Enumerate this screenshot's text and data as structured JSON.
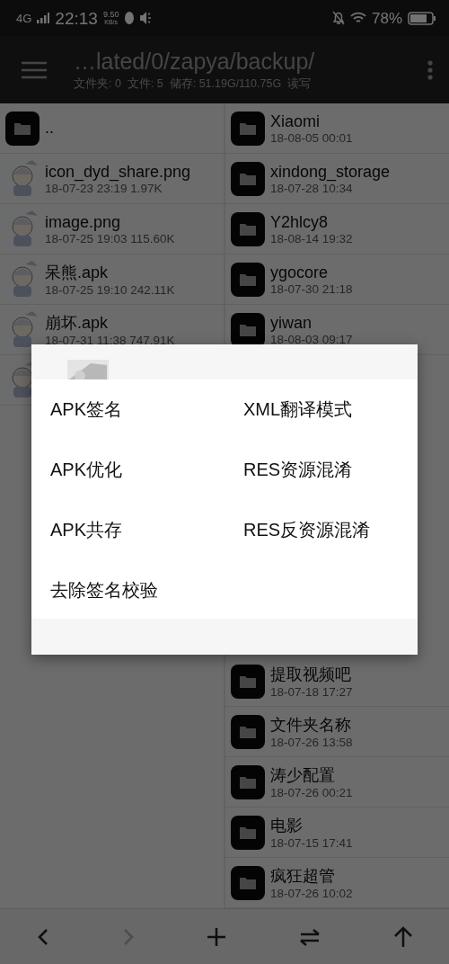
{
  "status_bar": {
    "network": "4G",
    "time": "22:13",
    "speed": "9.50",
    "speed_unit": "KB/s",
    "battery": "78%"
  },
  "app_bar": {
    "path": "…lated/0/zapya/backup/",
    "summary": "文件夹: 0  文件: 5  储存: 51.19G/110.75G  读写"
  },
  "left_pane": [
    {
      "kind": "folder",
      "name": ".."
    },
    {
      "kind": "picture",
      "name": "icon_dyd_share.png",
      "meta": "18-07-23 23:19  1.97K"
    },
    {
      "kind": "picture",
      "name": "image.png",
      "meta": "18-07-25 19:03  115.60K"
    },
    {
      "kind": "picture",
      "name": "呆熊.apk",
      "meta": "18-07-25 19:10  242.11K"
    },
    {
      "kind": "picture",
      "name": "崩坏.apk",
      "meta": "18-07-31 11:38  747.91K"
    },
    {
      "kind": "picture"
    }
  ],
  "right_pane_top": [
    {
      "kind": "folder",
      "name": "Xiaomi",
      "meta": "18-08-05 00:01"
    },
    {
      "kind": "folder",
      "name": "xindong_storage",
      "meta": "18-07-28 10:34"
    },
    {
      "kind": "folder",
      "name": "Y2hlcy8",
      "meta": "18-08-14 19:32"
    },
    {
      "kind": "folder",
      "name": "ygocore",
      "meta": "18-07-30 21:18"
    },
    {
      "kind": "folder",
      "name": "yiwan",
      "meta": "18-08-03 09:17"
    }
  ],
  "right_pane_bottom": [
    {
      "kind": "folder",
      "name": "提取视频吧",
      "meta": "18-07-18 17:27"
    },
    {
      "kind": "folder",
      "name": "文件夹名称",
      "meta": "18-07-26 13:58"
    },
    {
      "kind": "folder",
      "name": "涛少配置",
      "meta": "18-07-26 00:21"
    },
    {
      "kind": "folder",
      "name": "电影",
      "meta": "18-07-15 17:41"
    },
    {
      "kind": "folder",
      "name": "疯狂超管",
      "meta": "18-07-26 10:02"
    }
  ],
  "menu": [
    "APK签名",
    "XML翻译模式",
    "APK优化",
    "RES资源混淆",
    "APK共存",
    "RES反资源混淆",
    "去除签名校验"
  ],
  "bottom_bar": [
    {
      "kind": "back",
      "disabled": false
    },
    {
      "kind": "forward",
      "disabled": true
    },
    {
      "kind": "add",
      "disabled": false
    },
    {
      "kind": "swap",
      "disabled": false
    },
    {
      "kind": "up",
      "disabled": false
    }
  ]
}
